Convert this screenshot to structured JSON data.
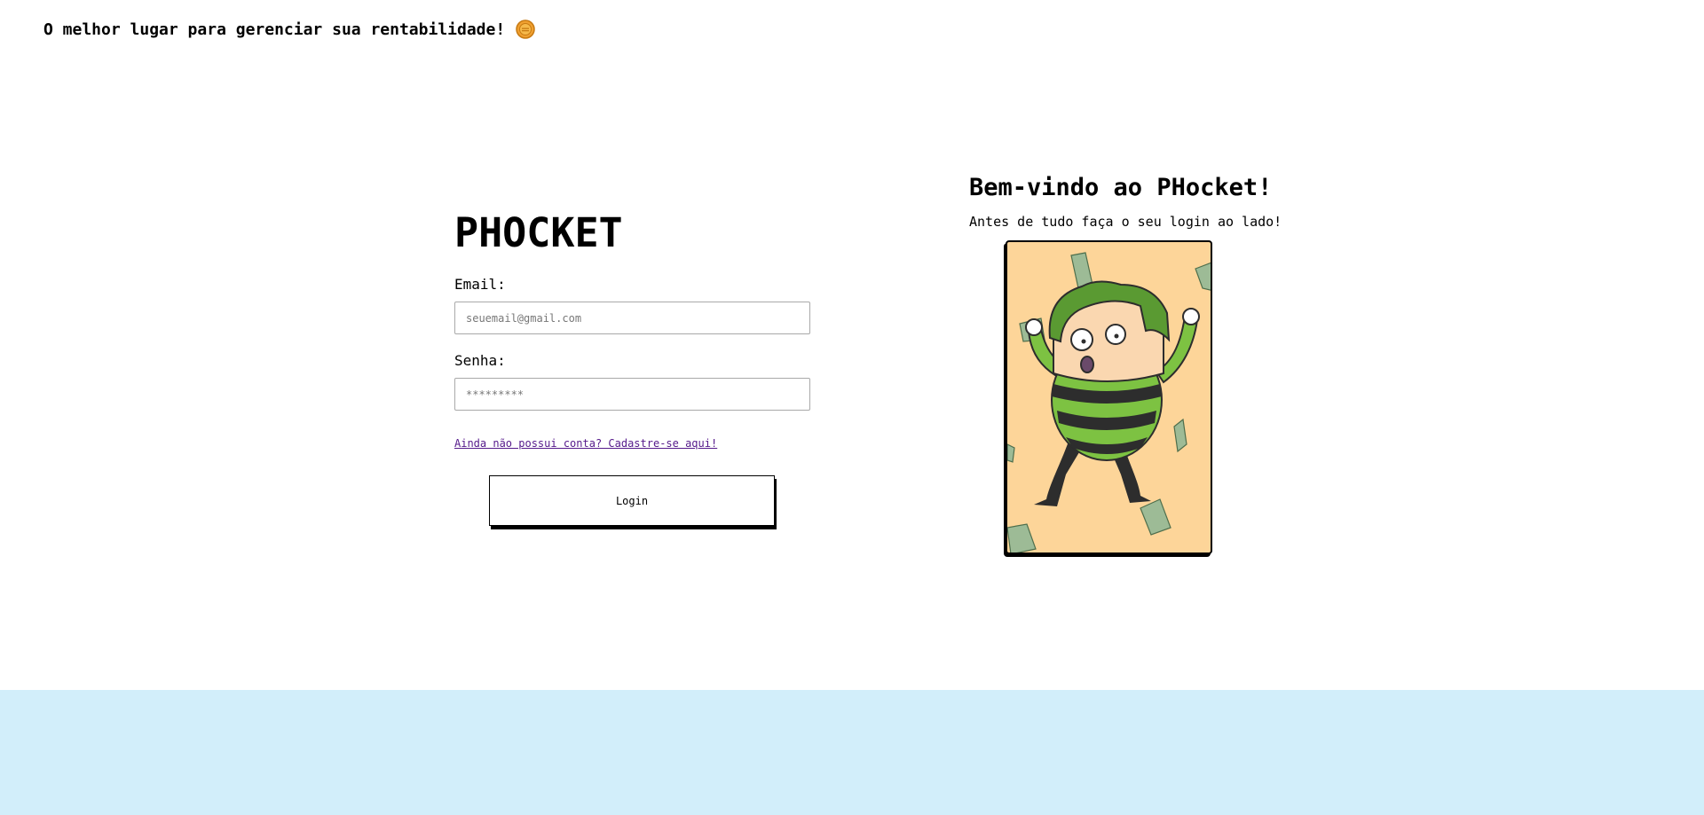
{
  "header": {
    "tagline": "O melhor lugar para gerenciar sua rentabilidade!",
    "coin_icon": "coin-icon"
  },
  "login": {
    "brand": "PHOCKET",
    "email_label": "Email:",
    "email_placeholder": "seuemail@gmail.com",
    "password_label": "Senha:",
    "password_placeholder": "*********",
    "signup_link": "Ainda não possui conta? Cadastre-se aqui!",
    "submit_label": "Login"
  },
  "welcome": {
    "title": "Bem-vindo ao PHocket!",
    "subtitle": "Antes de tudo faça o seu login ao lado!",
    "illustration": "money-character-illustration"
  },
  "colors": {
    "card_background": "#fdd599",
    "footer_background": "#d2eefa",
    "link": "#551a8b",
    "coin": "#f0a030",
    "shirt_green": "#7dc242",
    "hair_green": "#5a9a32"
  }
}
